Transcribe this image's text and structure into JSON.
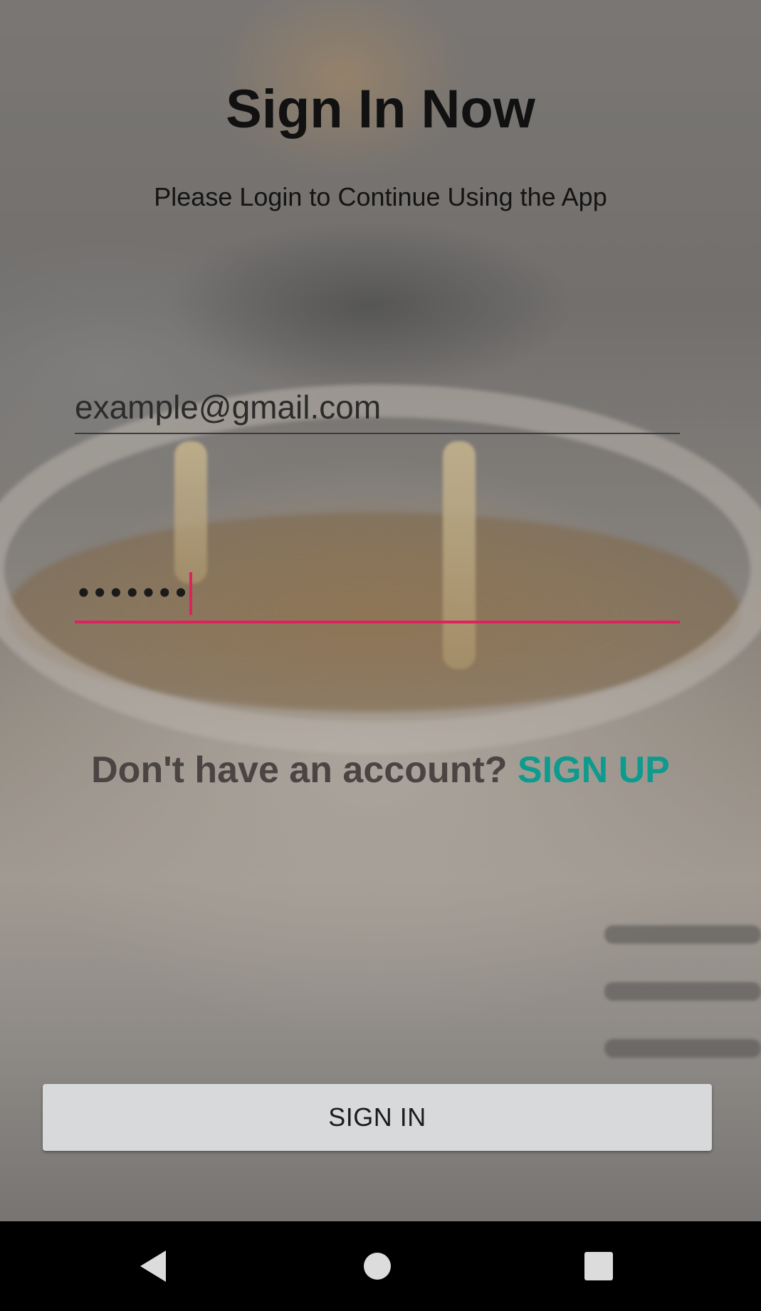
{
  "header": {
    "title": "Sign In Now",
    "subtitle": "Please Login to Continue Using the App"
  },
  "form": {
    "email_value": "example@gmail.com",
    "password_masked": "•••••••",
    "password_state": "focused"
  },
  "signup": {
    "prompt": "Don't have an account?",
    "link_label": "SIGN UP"
  },
  "actions": {
    "signin_label": "SIGN IN"
  },
  "navbar": {
    "buttons": [
      "back-icon",
      "home-icon",
      "recents-icon"
    ]
  },
  "colors": {
    "accent": "#e0215e",
    "link": "#0f9a8e",
    "button_bg": "#d7d9da",
    "navbar_bg": "#000000"
  }
}
